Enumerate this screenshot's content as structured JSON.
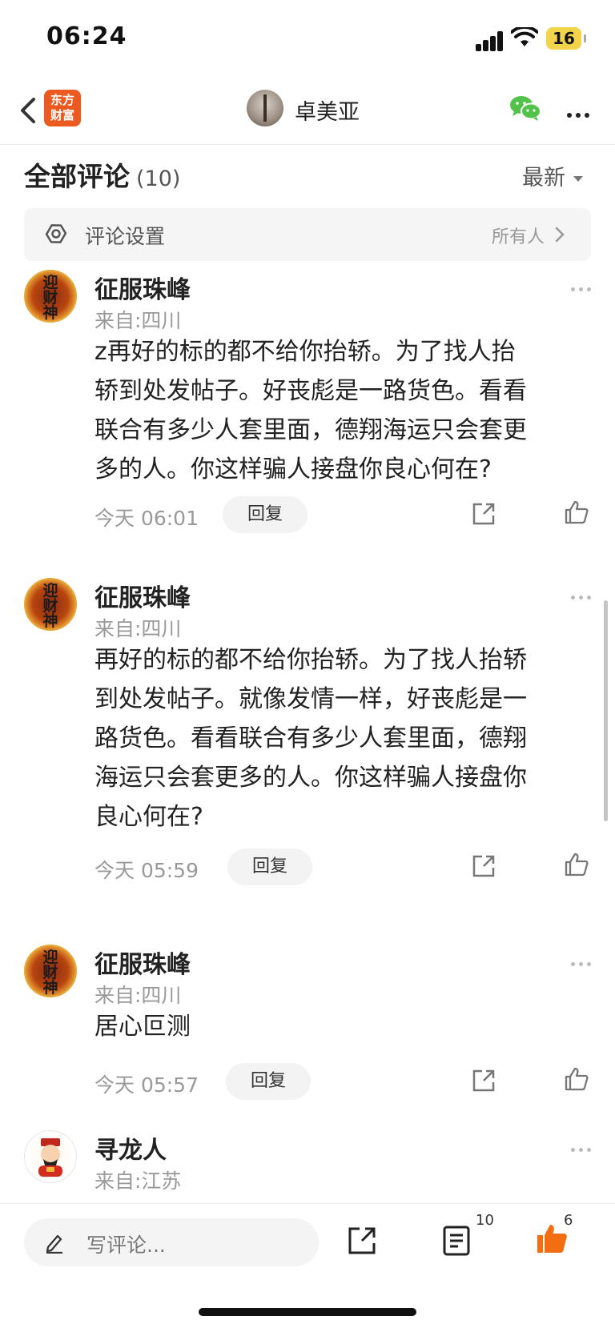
{
  "status_bar": {
    "time": "06:24",
    "battery": "16"
  },
  "nav": {
    "logo_line1": "东方",
    "logo_line2": "财富",
    "author": "卓美亚"
  },
  "section": {
    "title": "全部评论",
    "count": "(10)",
    "sort": "最新"
  },
  "settings": {
    "label": "评论设置",
    "value": "所有人"
  },
  "avatar_text": {
    "line1": "迎",
    "line2": "财",
    "line3": "神"
  },
  "comments": [
    {
      "name": "征服珠峰",
      "location": "来自:四川",
      "lines": [
        "z再好的标的都不给你抬轿。为了找人抬",
        "轿到处发帖子。好丧彪是一路货色。看看",
        "联合有多少人套里面，德翔海运只会套更",
        "多的人。你这样骗人接盘你良心何在?"
      ],
      "time": "今天 06:01",
      "reply": "回复"
    },
    {
      "name": "征服珠峰",
      "location": "来自:四川",
      "lines": [
        "再好的标的都不给你抬轿。为了找人抬轿",
        "到处发帖子。就像发情一样，好丧彪是一",
        "路货色。看看联合有多少人套里面，德翔",
        "海运只会套更多的人。你这样骗人接盘你",
        "良心何在?"
      ],
      "time": "今天 05:59",
      "reply": "回复"
    },
    {
      "name": "征服珠峰",
      "location": "来自:四川",
      "lines": [
        "居心叵测"
      ],
      "time": "今天 05:57",
      "reply": "回复"
    },
    {
      "name": "寻龙人",
      "location": "来自:江苏",
      "lines": []
    }
  ],
  "bottom": {
    "placeholder": "写评论...",
    "comment_count": "10",
    "like_count": "6"
  },
  "colors": {
    "accent": "#f36d12",
    "brand": "#ec5a1f",
    "wechat": "#52c24a"
  }
}
